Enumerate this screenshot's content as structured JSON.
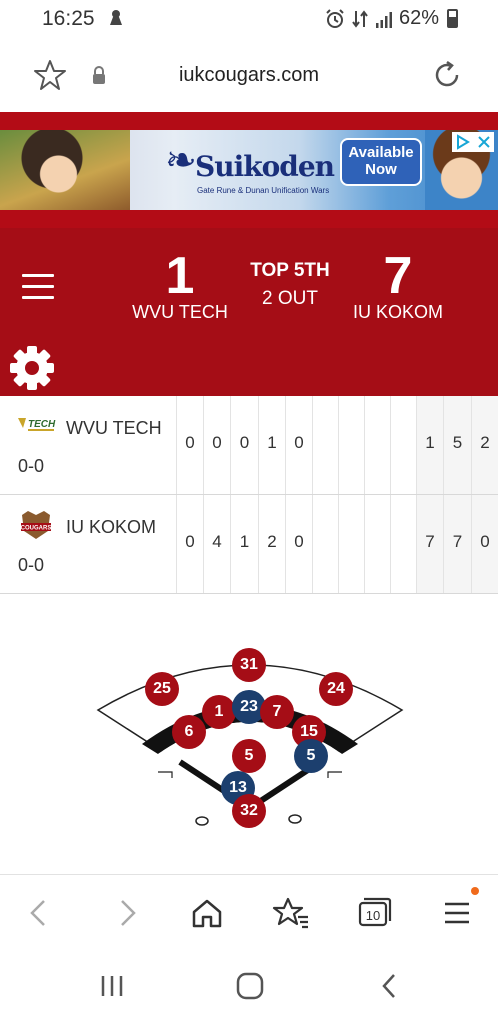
{
  "status_bar": {
    "time": "16:25",
    "battery": "62%"
  },
  "browser": {
    "url": "iukcougars.com"
  },
  "ad": {
    "brand": "Suikoden",
    "subtitle": "Gate Rune & Dunan Unification Wars",
    "cta": "Available Now"
  },
  "scoreboard": {
    "away_team": "WVU TECH",
    "away_score": "1",
    "home_team": "IU KOKOM",
    "home_score": "7",
    "inning": "TOP 5TH",
    "outs": "2 OUT"
  },
  "linescore": {
    "rows": [
      {
        "team": "WVU TECH",
        "logo_text": "TECH",
        "record": "0-0",
        "innings": [
          "0",
          "0",
          "0",
          "1",
          "0",
          "",
          "",
          "",
          ""
        ],
        "totals": [
          "1",
          "5",
          "2"
        ]
      },
      {
        "team": "IU KOKOM",
        "logo_text": "COUGARS",
        "record": "0-0",
        "innings": [
          "0",
          "4",
          "1",
          "2",
          "0",
          "",
          "",
          "",
          ""
        ],
        "totals": [
          "7",
          "7",
          "0"
        ]
      }
    ]
  },
  "field": {
    "players": [
      {
        "pos": "CF",
        "number": "31",
        "team": "home"
      },
      {
        "pos": "LF",
        "number": "25",
        "team": "home"
      },
      {
        "pos": "RF",
        "number": "24",
        "team": "home"
      },
      {
        "pos": "SS",
        "number": "6",
        "team": "home"
      },
      {
        "pos": "3B-runner",
        "number": "1",
        "team": "home"
      },
      {
        "pos": "2B-runner",
        "number": "23",
        "team": "away"
      },
      {
        "pos": "2B",
        "number": "7",
        "team": "home"
      },
      {
        "pos": "1B",
        "number": "15",
        "team": "home"
      },
      {
        "pos": "1B-runner",
        "number": "5",
        "team": "away"
      },
      {
        "pos": "P",
        "number": "5",
        "team": "home"
      },
      {
        "pos": "batter",
        "number": "13",
        "team": "away"
      },
      {
        "pos": "C",
        "number": "32",
        "team": "home"
      }
    ]
  },
  "colors": {
    "primary": "#a50d16",
    "away_player": "#1c3f6e",
    "notification_dot": "#f06a1b"
  }
}
